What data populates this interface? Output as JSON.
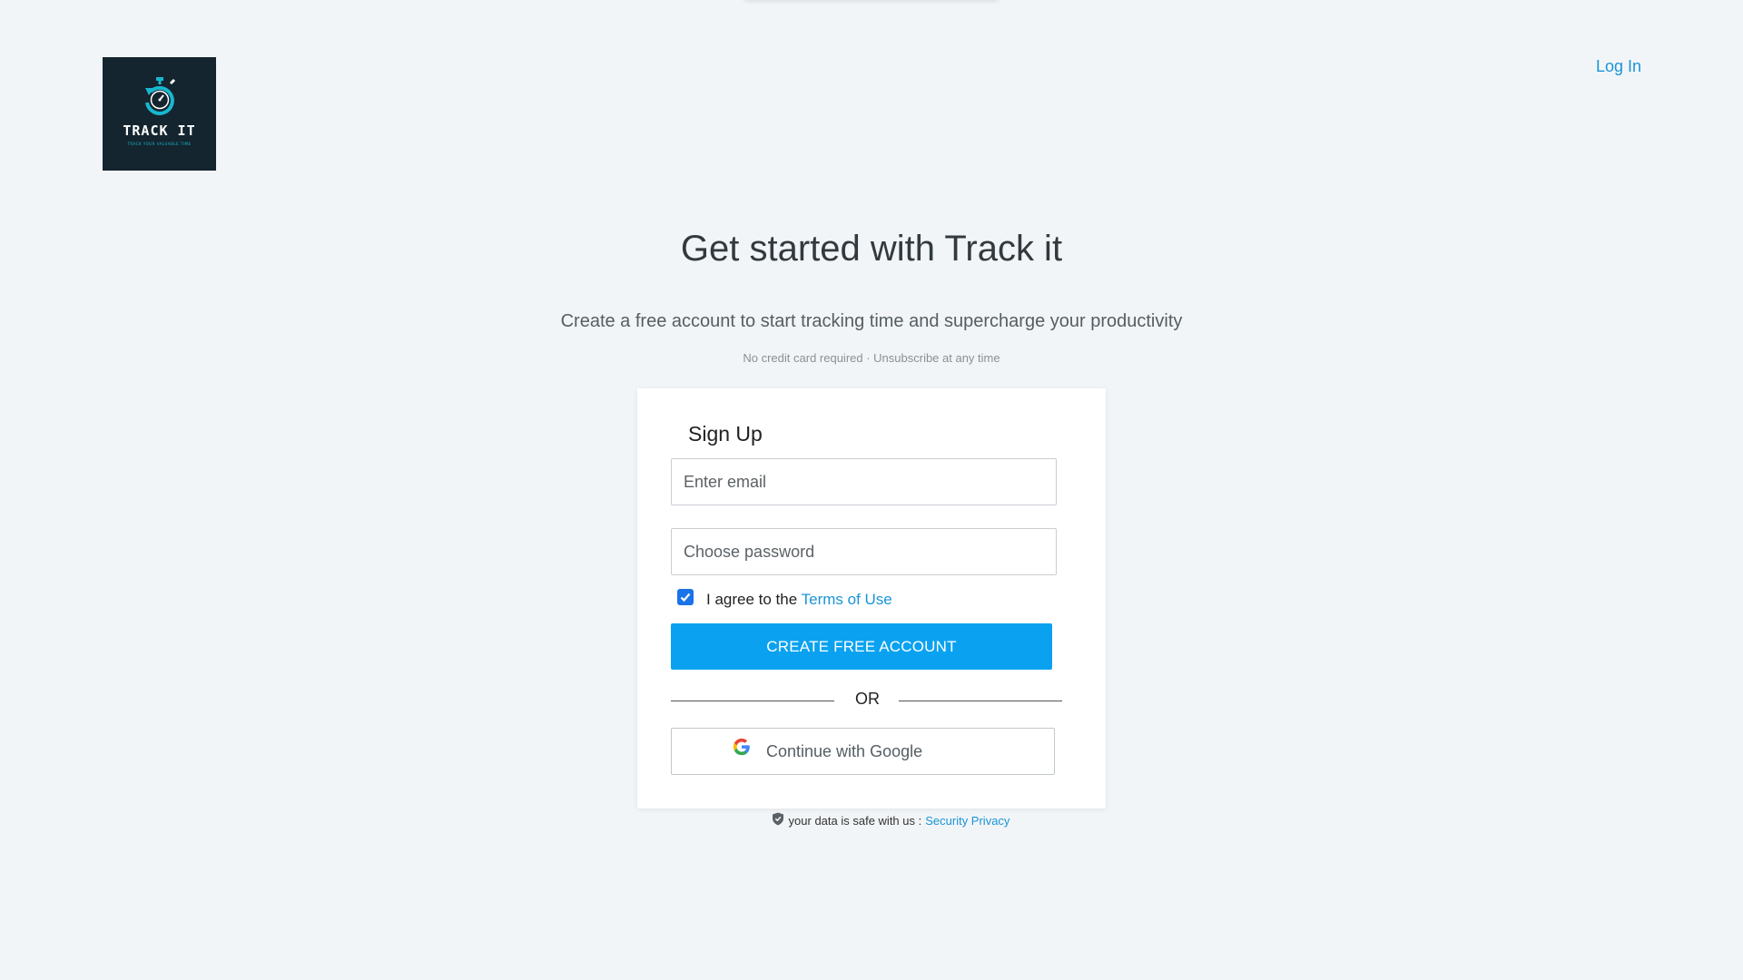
{
  "logo": {
    "title": "TRACK IT",
    "tagline": "TRACK YOUR VALUABLE TIME",
    "icon": "stopwatch-icon",
    "bg_color": "#14252f",
    "accent_color": "#19b7d0"
  },
  "header": {
    "login_label": "Log In"
  },
  "hero": {
    "title": "Get started with Track it",
    "subtitle": "Create a free account to start tracking time and supercharge your productivity",
    "note": "No credit card required · Unsubscribe at any time"
  },
  "signup": {
    "title": "Sign Up",
    "email_placeholder": "Enter email",
    "email_value": "",
    "password_placeholder": "Choose password",
    "password_value": "",
    "agree_checked": true,
    "agree_prefix": "I agree to the",
    "terms_label": "Terms of Use",
    "create_label": "CREATE FREE ACCOUNT",
    "or_label": "OR",
    "google_label": "Continue with Google",
    "google_icon": "google-icon"
  },
  "footer": {
    "secure_text": "your data is safe with us :",
    "secure_link": "Security Privacy",
    "shield_icon": "shield-icon"
  },
  "colors": {
    "primary": "#0aa2f0",
    "link": "#1a94d8",
    "background": "#f2f5f7"
  }
}
